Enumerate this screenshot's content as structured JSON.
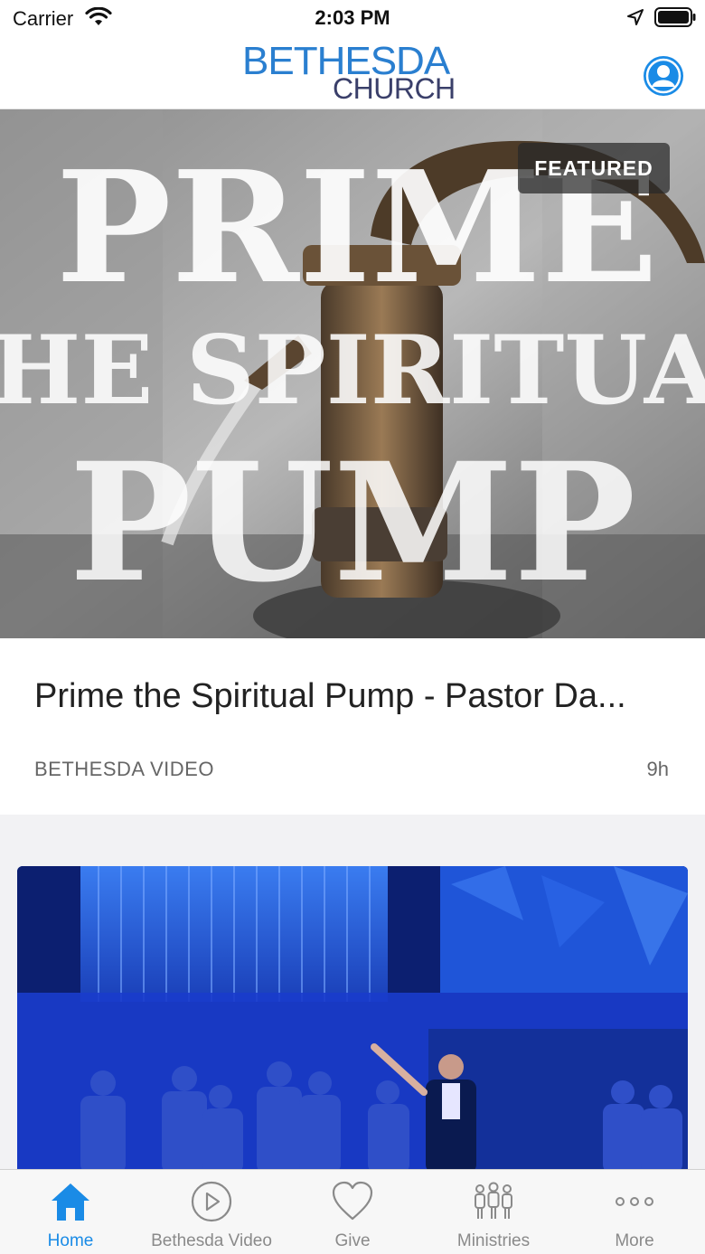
{
  "status_bar": {
    "carrier": "Carrier",
    "time": "2:03 PM"
  },
  "header": {
    "logo_line1": "BETHESDA",
    "logo_line2": "CHURCH",
    "accent_color": "#1a8be6"
  },
  "featured": {
    "badge": "FEATURED",
    "image_words": [
      "PRIME",
      "THE SPIRITUAL",
      "PUMP"
    ],
    "title": "Prime the Spiritual Pump - Pastor Da...",
    "source": "BETHESDA VIDEO",
    "age": "9h"
  },
  "tabs": [
    {
      "label": "Home",
      "icon": "home-icon",
      "active": true
    },
    {
      "label": "Bethesda Video",
      "icon": "play-circle-icon",
      "active": false
    },
    {
      "label": "Give",
      "icon": "heart-icon",
      "active": false
    },
    {
      "label": "Ministries",
      "icon": "people-icon",
      "active": false
    },
    {
      "label": "More",
      "icon": "more-dots-icon",
      "active": false
    }
  ]
}
